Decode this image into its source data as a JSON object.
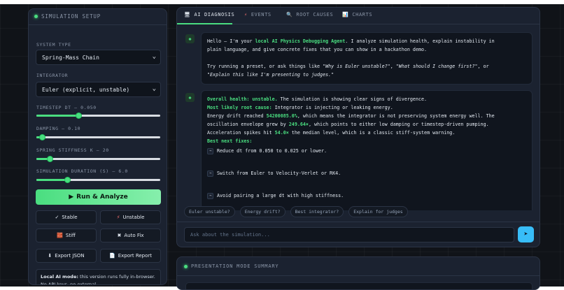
{
  "setup": {
    "title": "SIMULATION SETUP",
    "system_type_label": "SYSTEM TYPE",
    "system_type_value": "Spring-Mass Chain",
    "integrator_label": "INTEGRATOR",
    "integrator_value": "Euler (explicit, unstable)",
    "sliders": [
      {
        "label": "TIMESTEP DT — 0.050",
        "fraction": 0.34
      },
      {
        "label": "DAMPING — 0.10",
        "fraction": 0.05
      },
      {
        "label": "SPRING STIFFNESS K — 20",
        "fraction": 0.11
      },
      {
        "label": "SIMULATION DURATION (S) — 6.0",
        "fraction": 0.25
      }
    ],
    "run_button": "Run & Analyze",
    "presets": [
      {
        "label": "Stable",
        "icon": "✓"
      },
      {
        "label": "Unstable",
        "icon": "⚡"
      },
      {
        "label": "Stiff",
        "icon": "🧱"
      },
      {
        "label": "Auto Fix",
        "icon": "✖"
      },
      {
        "label": "Export JSON",
        "icon": "⬇"
      },
      {
        "label": "Export Report",
        "icon": "📄"
      }
    ],
    "local_note_bold": "Local AI mode:",
    "local_note_text": " this version runs fully in-browser. No API keys, no external"
  },
  "tabs": [
    {
      "label": "AI DIAGNOSIS",
      "icon": "🖥"
    },
    {
      "label": "EVENTS",
      "icon": "⚡"
    },
    {
      "label": "ROOT CAUSES",
      "icon": "🔍"
    },
    {
      "label": "CHARTS",
      "icon": "📊"
    }
  ],
  "chat": {
    "intro_line1_a": "Hello — I'm your ",
    "intro_line1_b": "local AI Physics Debugging Agent",
    "intro_line1_c": ". I analyze simulation health, explain instability in",
    "intro_line2": "plain language, and give concrete fixes that you can show in a hackathon demo.",
    "intro_line3_a": "Try running a preset, or ask things like ",
    "intro_line3_b": "\"Why is Euler unstable?\"",
    "intro_line3_c": ", ",
    "intro_line3_d": "\"What should I change first?\"",
    "intro_line3_e": ", or",
    "intro_line4": "\"Explain this like I'm presenting to judges.\"",
    "health_label": "Overall health: unstable.",
    "health_text": " The simulation is showing clear signs of divergence.",
    "root_label": "Most likely root cause:",
    "root_text": " Integrator is injecting or leaking energy.",
    "drift_a": "Energy drift reached ",
    "drift_value": "54200085.0%",
    "drift_b": ", which means the integrator is not preserving system energy well. The",
    "osc_a": "oscillation envelope grew by ",
    "osc_value": "249.64×",
    "osc_b": ", which points to either low damping or timestep-driven pumping.",
    "acc_a": "Acceleration spikes hit ",
    "acc_value": "54.0×",
    "acc_b": " the median level, which is a classic stiff-system warning.",
    "fixes_label": "Best next fixes:",
    "fixes": [
      "Reduce dt from 0.050 to 0.025 or lower.",
      "Switch from Euler to Velocity-Verlet or RK4.",
      "Avoid pairing a large dt with high stiffness."
    ]
  },
  "chips": [
    "Euler unstable?",
    "Energy drift?",
    "Best integrator?",
    "Explain for judges"
  ],
  "ask_placeholder": "Ask about the simulation...",
  "send_icon": "➤",
  "presentation": {
    "title": "PRESENTATION MODE SUMMARY"
  },
  "colors": {
    "accent": "#4ade80",
    "send": "#38bdf8",
    "panel": "#1b2230",
    "background": "#101318"
  }
}
